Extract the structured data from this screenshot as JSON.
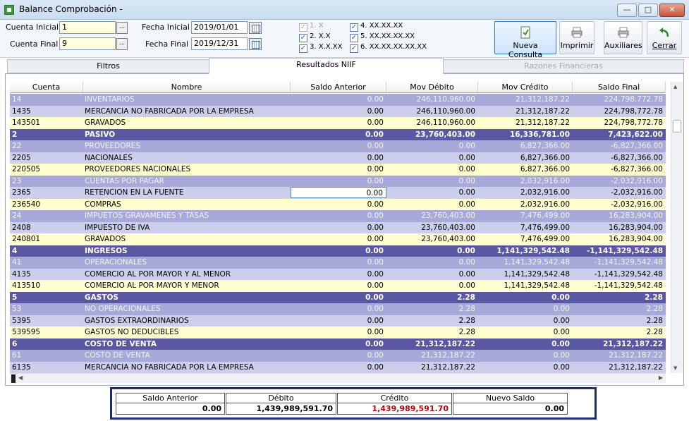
{
  "window": {
    "title": "Balance Comprobación -"
  },
  "filters": {
    "cuenta_inicial_label": "Cuenta Inicial :",
    "cuenta_inicial_value": "1",
    "cuenta_final_label": "Cuenta Final :",
    "cuenta_final_value": "9",
    "fecha_inicial_label": "Fecha Inicial :",
    "fecha_inicial_value": "2019/01/01",
    "fecha_final_label": "Fecha Final :",
    "fecha_final_value": "2019/12/31",
    "dots_label": "...",
    "levels": [
      {
        "label": "1. X",
        "checked": true,
        "disabled": true
      },
      {
        "label": "2. X.X",
        "checked": true,
        "disabled": false
      },
      {
        "label": "3. X.X.XX",
        "checked": true,
        "disabled": false
      },
      {
        "label": "4. XX.XX.XX",
        "checked": true,
        "disabled": false
      },
      {
        "label": "5. XX.XX.XX.XX",
        "checked": true,
        "disabled": false
      },
      {
        "label": "6. XX.XX.XX.XX.XX",
        "checked": true,
        "disabled": false
      }
    ]
  },
  "toolbar": {
    "nueva_consulta": "Nueva Consulta",
    "imprimir": "Imprimir",
    "auxiliares": "Auxiliares",
    "cerrar": "Cerrar"
  },
  "tabs": [
    {
      "label": "Filtros",
      "active": false,
      "disabled": false
    },
    {
      "label": "Resultados NIIF",
      "active": true,
      "disabled": false
    },
    {
      "label": "Razones Financieras",
      "active": false,
      "disabled": true
    }
  ],
  "grid": {
    "columns": [
      "Cuenta",
      "Nombre",
      "Saldo Anterior",
      "Mov Débito",
      "Mov Crédito",
      "Saldo Final"
    ],
    "rows": [
      {
        "level": 2,
        "cuenta": "14",
        "nombre": "INVENTARIOS",
        "saldo_anterior": "0.00",
        "debito": "246,110,960.00",
        "credito": "21,312,187.22",
        "saldo_final": "224,798,772.78"
      },
      {
        "level": 3,
        "cuenta": "1435",
        "nombre": "MERCANCIA NO FABRICADA POR LA EMPRESA",
        "saldo_anterior": "0.00",
        "debito": "246,110,960.00",
        "credito": "21,312,187.22",
        "saldo_final": "224,798,772.78"
      },
      {
        "level": 4,
        "cuenta": "143501",
        "nombre": "GRAVADOS",
        "saldo_anterior": "0.00",
        "debito": "246,110,960.00",
        "credito": "21,312,187.22",
        "saldo_final": "224,798,772.78"
      },
      {
        "level": 1,
        "cuenta": "2",
        "nombre": "PASIVO",
        "saldo_anterior": "0.00",
        "debito": "23,760,403.00",
        "credito": "16,336,781.00",
        "saldo_final": "7,423,622.00"
      },
      {
        "level": 2,
        "cuenta": "22",
        "nombre": "PROVEEDORES",
        "saldo_anterior": "0.00",
        "debito": "0.00",
        "credito": "6,827,366.00",
        "saldo_final": "-6,827,366.00"
      },
      {
        "level": 3,
        "cuenta": "2205",
        "nombre": "NACIONALES",
        "saldo_anterior": "0.00",
        "debito": "0.00",
        "credito": "6,827,366.00",
        "saldo_final": "-6,827,366.00"
      },
      {
        "level": 4,
        "cuenta": "220505",
        "nombre": "PROVEEDORES NACIONALES",
        "saldo_anterior": "0.00",
        "debito": "0.00",
        "credito": "6,827,366.00",
        "saldo_final": "-6,827,366.00"
      },
      {
        "level": 2,
        "cuenta": "23",
        "nombre": "CUENTAS POR PAGAR",
        "saldo_anterior": "0.00",
        "debito": "0.00",
        "credito": "2,032,916.00",
        "saldo_final": "-2,032,916.00"
      },
      {
        "level": 3,
        "cuenta": "2365",
        "nombre": "RETENCION EN LA FUENTE",
        "saldo_anterior": "0.00",
        "debito": "0.00",
        "credito": "2,032,916.00",
        "saldo_final": "-2,032,916.00",
        "selected": true
      },
      {
        "level": 4,
        "cuenta": "236540",
        "nombre": "COMPRAS",
        "saldo_anterior": "0.00",
        "debito": "0.00",
        "credito": "2,032,916.00",
        "saldo_final": "-2,032,916.00"
      },
      {
        "level": 2,
        "cuenta": "24",
        "nombre": "IMPUETOS GRAVAMENES Y TASAS",
        "saldo_anterior": "0.00",
        "debito": "23,760,403.00",
        "credito": "7,476,499.00",
        "saldo_final": "16,283,904.00"
      },
      {
        "level": 3,
        "cuenta": "2408",
        "nombre": "IMPUESTO DE IVA",
        "saldo_anterior": "0.00",
        "debito": "23,760,403.00",
        "credito": "7,476,499.00",
        "saldo_final": "16,283,904.00"
      },
      {
        "level": 4,
        "cuenta": "240801",
        "nombre": "GRAVADOS",
        "saldo_anterior": "0.00",
        "debito": "23,760,403.00",
        "credito": "7,476,499.00",
        "saldo_final": "16,283,904.00"
      },
      {
        "level": 1,
        "cuenta": "4",
        "nombre": "INGRESOS",
        "saldo_anterior": "0.00",
        "debito": "0.00",
        "credito": "1,141,329,542.48",
        "saldo_final": "-1,141,329,542.48"
      },
      {
        "level": 2,
        "cuenta": "41",
        "nombre": "OPERACIONALES",
        "saldo_anterior": "0.00",
        "debito": "0.00",
        "credito": "1,141,329,542.48",
        "saldo_final": "-1,141,329,542.48"
      },
      {
        "level": 3,
        "cuenta": "4135",
        "nombre": "COMERCIO AL POR MAYOR Y AL MENOR",
        "saldo_anterior": "0.00",
        "debito": "0.00",
        "credito": "1,141,329,542.48",
        "saldo_final": "-1,141,329,542.48"
      },
      {
        "level": 4,
        "cuenta": "413510",
        "nombre": "COMERCIO AL POR MAYOR Y MENOR",
        "saldo_anterior": "0.00",
        "debito": "0.00",
        "credito": "1,141,329,542.48",
        "saldo_final": "-1,141,329,542.48"
      },
      {
        "level": 1,
        "cuenta": "5",
        "nombre": "GASTOS",
        "saldo_anterior": "0.00",
        "debito": "2.28",
        "credito": "0.00",
        "saldo_final": "2.28"
      },
      {
        "level": 2,
        "cuenta": "53",
        "nombre": "NO OPERACIONALES",
        "saldo_anterior": "0.00",
        "debito": "2.28",
        "credito": "0.00",
        "saldo_final": "2.28"
      },
      {
        "level": 3,
        "cuenta": "5395",
        "nombre": "GASTOS EXTRAORDINARIOS",
        "saldo_anterior": "0.00",
        "debito": "2.28",
        "credito": "0.00",
        "saldo_final": "2.28"
      },
      {
        "level": 4,
        "cuenta": "539595",
        "nombre": "GASTOS NO DEDUCIBLES",
        "saldo_anterior": "0.00",
        "debito": "2.28",
        "credito": "0.00",
        "saldo_final": "2.28"
      },
      {
        "level": 1,
        "cuenta": "6",
        "nombre": "COSTO DE VENTA",
        "saldo_anterior": "0.00",
        "debito": "21,312,187.22",
        "credito": "0.00",
        "saldo_final": "21,312,187.22"
      },
      {
        "level": 2,
        "cuenta": "61",
        "nombre": "COSTO DE VENTA",
        "saldo_anterior": "0.00",
        "debito": "21,312,187.22",
        "credito": "0.00",
        "saldo_final": "21,312,187.22"
      },
      {
        "level": 3,
        "cuenta": "6135",
        "nombre": "MERCANCIA NO FABRICADA POR LA EMPRESA",
        "saldo_anterior": "0.00",
        "debito": "21,312,187.22",
        "credito": "0.00",
        "saldo_final": "21,312,187.22"
      }
    ]
  },
  "totals": {
    "saldo_anterior_label": "Saldo Anterior",
    "debito_label": "Débito",
    "credito_label": "Crédito",
    "nuevo_saldo_label": "Nuevo Saldo",
    "saldo_anterior": "0.00",
    "debito": "1,439,989,591.70",
    "credito": "1,439,989,591.70",
    "nuevo_saldo": "0.00"
  },
  "colors": {
    "level1_row": "#5a57a3",
    "level2_row": "#a7a9d9",
    "level3_row": "#ccceeb",
    "level4_row": "#ffffcf",
    "credit_total": "#c0000f"
  },
  "icons": {
    "nueva_consulta": "new-document-icon",
    "imprimir": "printer-icon",
    "auxiliares": "printer-icon",
    "cerrar": "undo-arrow-icon"
  }
}
